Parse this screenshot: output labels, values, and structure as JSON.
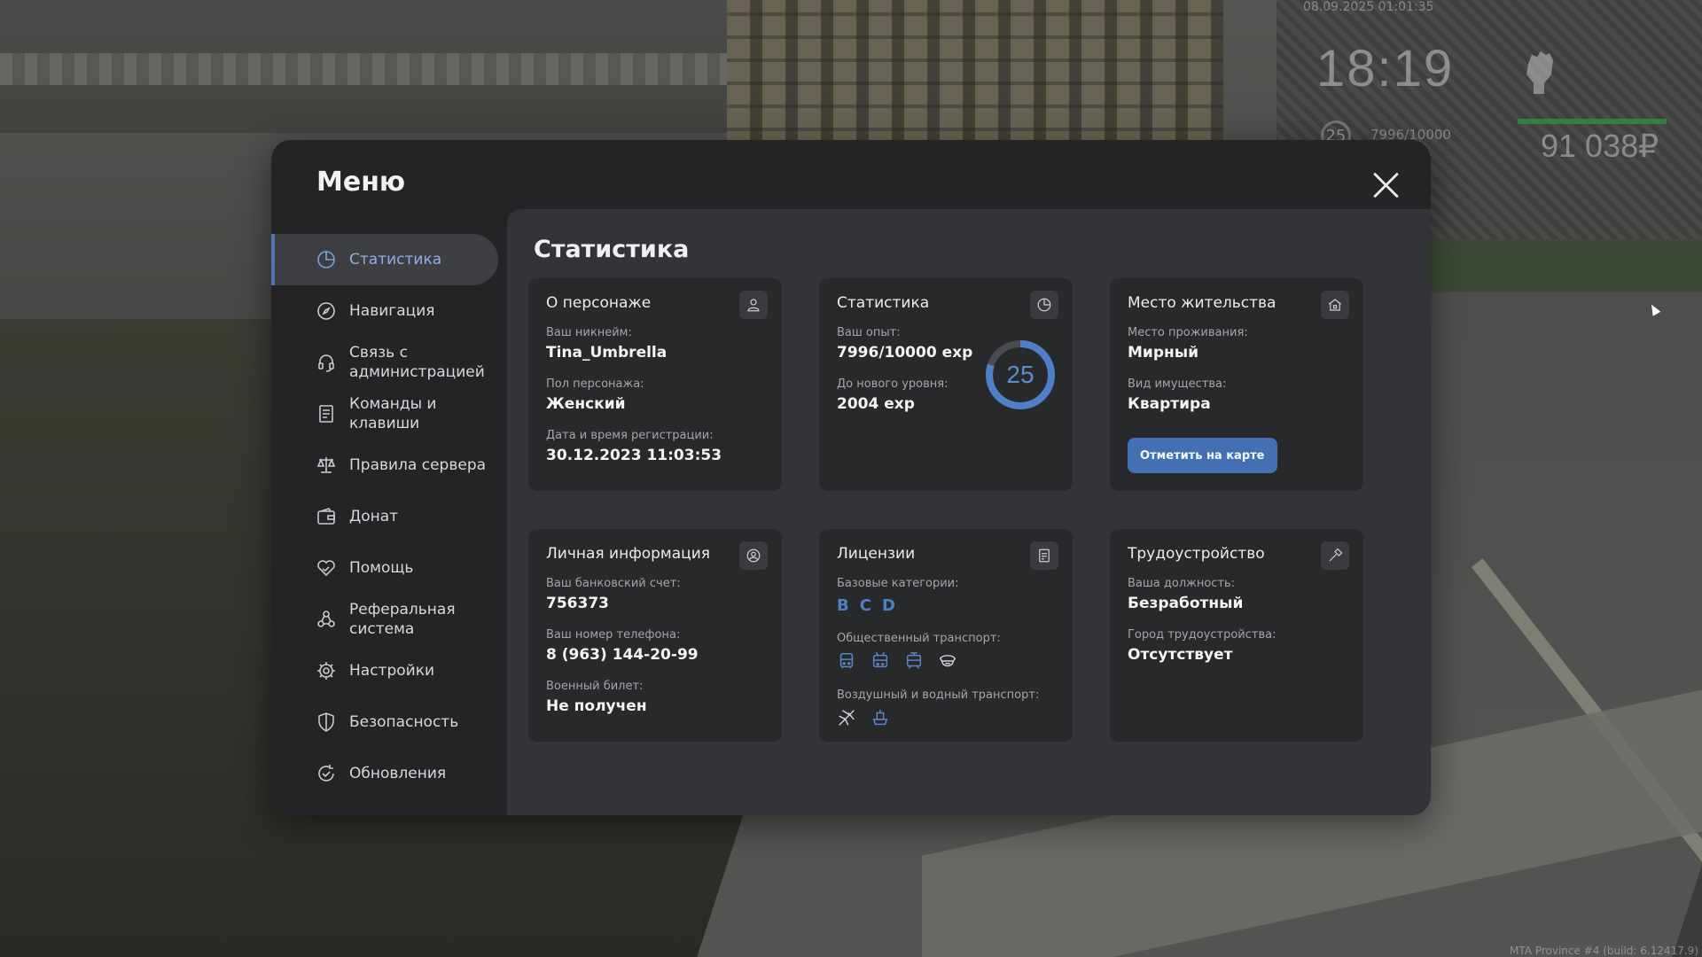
{
  "hud": {
    "datetime": "08.09.2025 01:01:35",
    "time": "18:19",
    "level": "25",
    "exp": "7996/10000",
    "money": "91 038₽",
    "build": "MTA Province #4 (build: 6.12417.9)"
  },
  "menu": {
    "title": "Меню",
    "nav": [
      {
        "label": "Статистика",
        "icon": "pie-chart-icon",
        "active": true
      },
      {
        "label": "Навигация",
        "icon": "compass-icon"
      },
      {
        "label": "Связь с\nадминистрацией",
        "icon": "headset-icon"
      },
      {
        "label": "Команды и\nклавиши",
        "icon": "document-icon"
      },
      {
        "label": "Правила сервера",
        "icon": "scales-icon"
      },
      {
        "label": "Донат",
        "icon": "wallet-icon"
      },
      {
        "label": "Помощь",
        "icon": "heart-hand-icon"
      },
      {
        "label": "Реферальная\nсистема",
        "icon": "people-icon"
      },
      {
        "label": "Настройки",
        "icon": "gear-icon"
      },
      {
        "label": "Безопасность",
        "icon": "shield-icon"
      },
      {
        "label": "Обновления",
        "icon": "refresh-check-icon"
      }
    ]
  },
  "content": {
    "title": "Статистика",
    "character": {
      "title": "О персонаже",
      "nick_label": "Ваш никнейм:",
      "nick": "Tina_Umbrella",
      "gender_label": "Пол персонажа:",
      "gender": "Женский",
      "reg_label": "Дата и время регистрации:",
      "reg": "30.12.2023 11:03:53"
    },
    "stats": {
      "title": "Статистика",
      "exp_label": "Ваш опыт:",
      "exp": "7996/10000 exp",
      "next_label": "До нового уровня:",
      "next": "2004 exp",
      "level": "25",
      "progress": 0.7996
    },
    "residence": {
      "title": "Место жительства",
      "place_label": "Место проживания:",
      "place": "Мирный",
      "prop_label": "Вид имущества:",
      "prop": "Квартира",
      "map_button": "Отметить на карте"
    },
    "personal": {
      "title": "Личная информация",
      "bank_label": "Ваш банковский счет:",
      "bank": "756373",
      "phone_label": "Ваш номер телефона:",
      "phone": "8 (963) 144-20-99",
      "military_label": "Военный билет:",
      "military": "Не получен"
    },
    "licenses": {
      "title": "Лицензии",
      "base_label": "Базовые категории:",
      "categories": [
        "B",
        "C",
        "D"
      ],
      "public_label": "Общественный транспорт:",
      "public_icons": [
        "bus-icon",
        "trolleybus-icon",
        "tram-icon",
        "driver-cap-icon"
      ],
      "air_label": "Воздушный и водный транспорт:",
      "air_icons": [
        "plane-icon",
        "boat-icon"
      ]
    },
    "job": {
      "title": "Трудоустройство",
      "position_label": "Ваша должность:",
      "position": "Безработный",
      "city_label": "Город трудоустройства:",
      "city": "Отсутствует"
    }
  },
  "colors": {
    "accent": "#4b77b7",
    "panel": "#242426",
    "content": "#333437",
    "card": "#28292b"
  }
}
